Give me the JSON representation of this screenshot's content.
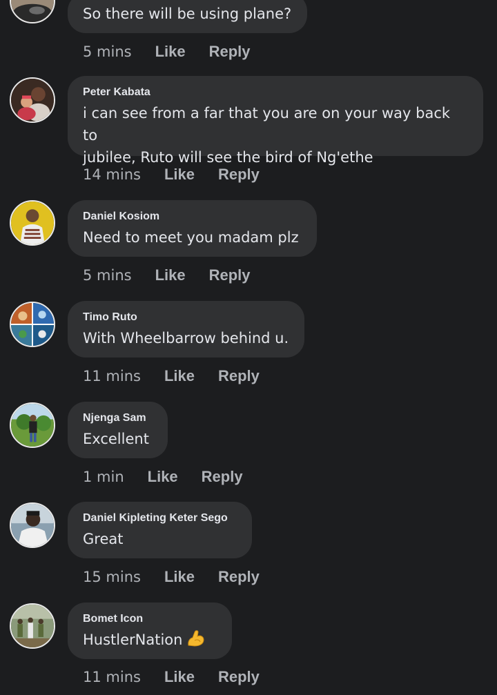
{
  "comments": [
    {
      "author": "",
      "text": "So there will be using plane?",
      "time": "5 mins",
      "like": "Like",
      "reply": "Reply",
      "avatar": "avatar-partial"
    },
    {
      "author": "Peter Kabata",
      "text": "i can see from a far that you are on your way back to\njubilee, Ruto will see the bird of Ng'ethe",
      "time": "14 mins",
      "like": "Like",
      "reply": "Reply",
      "avatar": "avatar-peter"
    },
    {
      "author": "Daniel Kosiom",
      "text": "Need to meet you madam plz",
      "time": "5 mins",
      "like": "Like",
      "reply": "Reply",
      "avatar": "avatar-daniel-k"
    },
    {
      "author": "Timo Ruto",
      "text": "With Wheelbarrow behind u.",
      "time": "11 mins",
      "like": "Like",
      "reply": "Reply",
      "avatar": "avatar-timo"
    },
    {
      "author": "Njenga Sam",
      "text": "Excellent",
      "time": "1 min",
      "like": "Like",
      "reply": "Reply",
      "avatar": "avatar-njenga"
    },
    {
      "author": "Daniel Kipleting Keter Sego",
      "text": "Great",
      "time": "15 mins",
      "like": "Like",
      "reply": "Reply",
      "avatar": "avatar-sego"
    },
    {
      "author": "Bomet Icon",
      "text": "HustlerNation",
      "time": "11 mins",
      "like": "Like",
      "reply": "Reply",
      "avatar": "avatar-bomet",
      "emoji": "flexed-biceps-icon"
    }
  ],
  "colors": {
    "background": "#1c1d1f",
    "bubble": "#303133",
    "primary_text": "#e4e6eb",
    "secondary_text": "#b0b3b8"
  }
}
